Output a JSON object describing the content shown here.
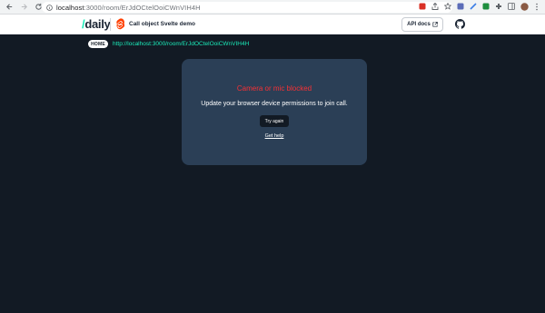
{
  "browser": {
    "url_host": "localhost",
    "url_rest": ":3000/room/ErJdOCtelOoiCWnVIH4H"
  },
  "header": {
    "logo_slash": "/",
    "logo_text": "daily",
    "app_title": "Call object Svelte demo",
    "api_docs_label": "API docs"
  },
  "breadcrumb": {
    "home_label": "HOME",
    "room_url": "http://localhost:3000/room/ErJdOCtelOoiCWnVIH4H"
  },
  "error_card": {
    "title": "Camera or mic blocked",
    "message": "Update your browser device permissions to join call.",
    "retry_label": "Try again",
    "help_label": "Get help"
  },
  "colors": {
    "background": "#121a24",
    "card": "#2b3f56",
    "accent": "#1bebb9",
    "error": "#f63135"
  },
  "icons": [
    "back-arrow-icon",
    "forward-arrow-icon",
    "reload-icon",
    "lock-icon",
    "svelte-logo-icon",
    "external-link-icon",
    "github-icon",
    "extension-icon",
    "profile-avatar-icon"
  ]
}
